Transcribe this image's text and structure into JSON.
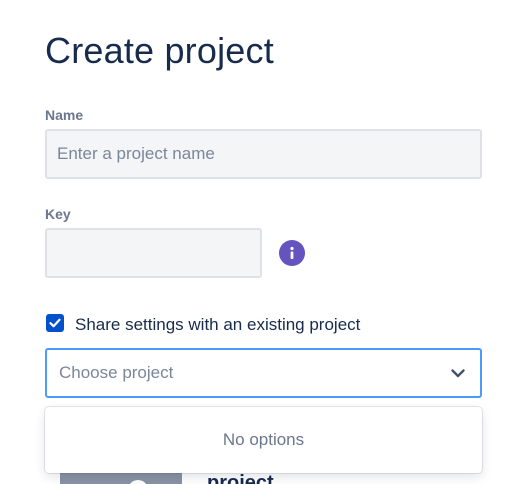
{
  "page": {
    "title": "Create project"
  },
  "form": {
    "name": {
      "label": "Name",
      "placeholder": "Enter a project name",
      "value": ""
    },
    "key": {
      "label": "Key",
      "value": "",
      "info_icon": "info-icon"
    },
    "share_settings": {
      "checked": true,
      "label": "Share settings with an existing project"
    },
    "project_select": {
      "placeholder": "Choose project",
      "icon": "chevron-down-icon",
      "menu": {
        "empty_text": "No options"
      }
    }
  },
  "behind": {
    "partial_text": "project"
  },
  "colors": {
    "heading": "#172b4d",
    "label": "#6b778c",
    "field_bg": "#f4f5f7",
    "field_border": "#dfe1e6",
    "focus_border": "#4c9aff",
    "checkbox": "#0052cc",
    "info": "#6554c0"
  }
}
